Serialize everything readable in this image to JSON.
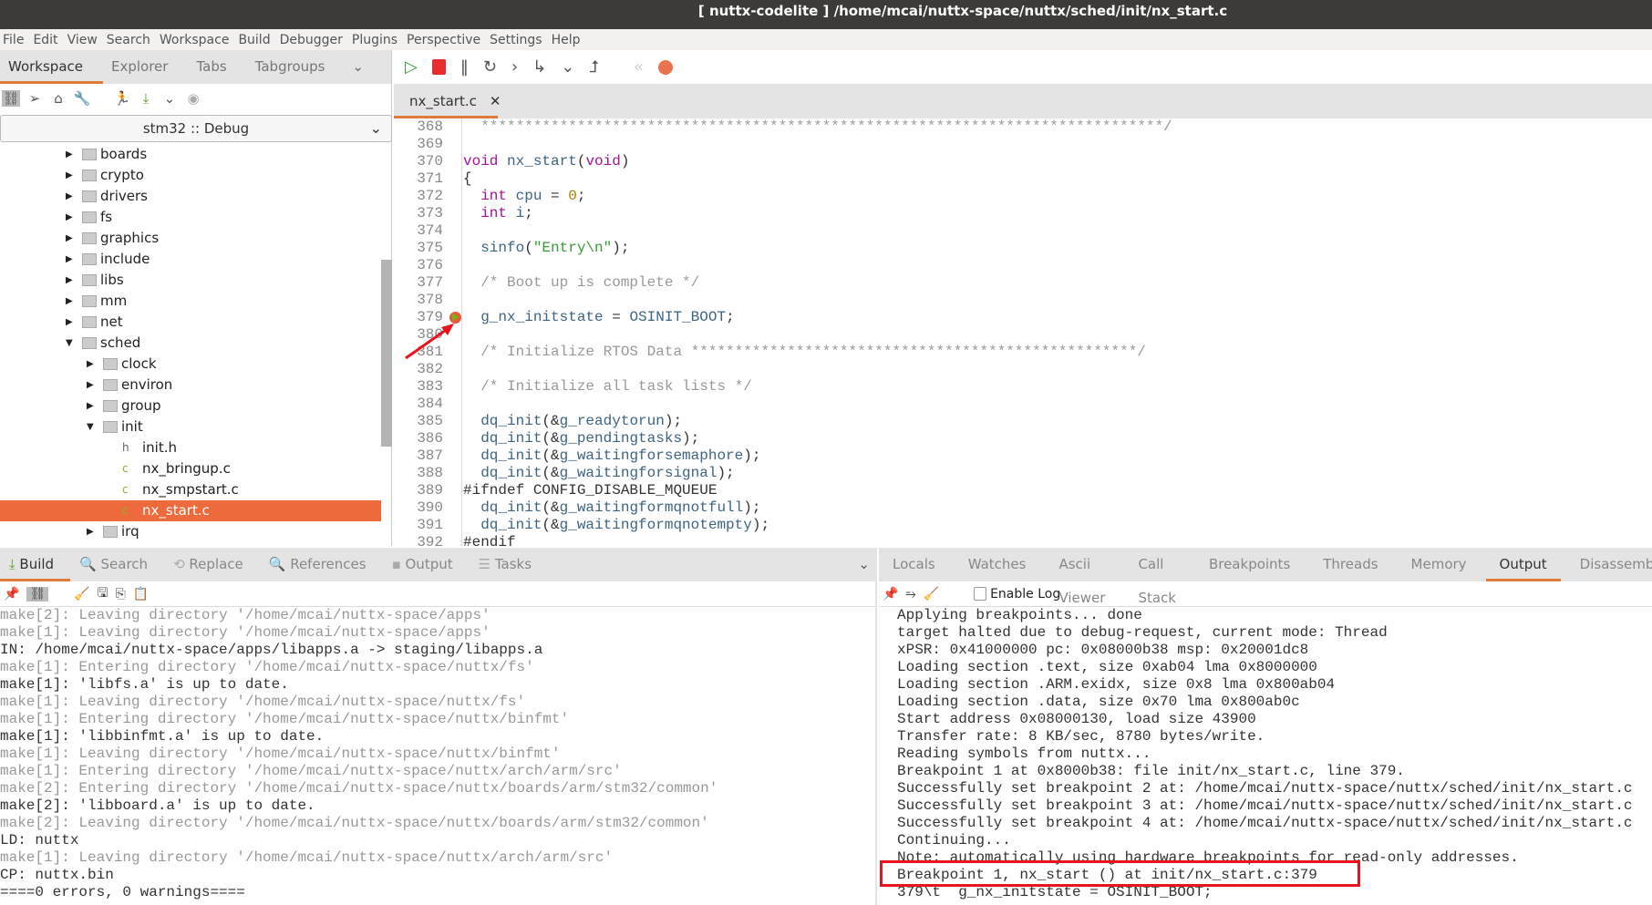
{
  "title": "[ nuttx-codelite ] /home/mcai/nuttx-space/nuttx/sched/init/nx_start.c",
  "menu": [
    "File",
    "Edit",
    "View",
    "Search",
    "Workspace",
    "Build",
    "Debugger",
    "Plugins",
    "Perspective",
    "Settings",
    "Help"
  ],
  "sidebar": {
    "tabs": [
      "Workspace",
      "Explorer",
      "Tabs",
      "Tabgroups"
    ],
    "project": "stm32 :: Debug",
    "tree": [
      {
        "label": "boards",
        "depth": 0,
        "type": "folder",
        "open": false
      },
      {
        "label": "crypto",
        "depth": 0,
        "type": "folder",
        "open": false
      },
      {
        "label": "drivers",
        "depth": 0,
        "type": "folder",
        "open": false
      },
      {
        "label": "fs",
        "depth": 0,
        "type": "folder",
        "open": false
      },
      {
        "label": "graphics",
        "depth": 0,
        "type": "folder",
        "open": false
      },
      {
        "label": "include",
        "depth": 0,
        "type": "folder",
        "open": false
      },
      {
        "label": "libs",
        "depth": 0,
        "type": "folder",
        "open": false
      },
      {
        "label": "mm",
        "depth": 0,
        "type": "folder",
        "open": false
      },
      {
        "label": "net",
        "depth": 0,
        "type": "folder",
        "open": false
      },
      {
        "label": "sched",
        "depth": 0,
        "type": "folder",
        "open": true
      },
      {
        "label": "clock",
        "depth": 1,
        "type": "folder",
        "open": false
      },
      {
        "label": "environ",
        "depth": 1,
        "type": "folder",
        "open": false
      },
      {
        "label": "group",
        "depth": 1,
        "type": "folder",
        "open": false
      },
      {
        "label": "init",
        "depth": 1,
        "type": "folder",
        "open": true
      },
      {
        "label": "init.h",
        "depth": 2,
        "type": "h"
      },
      {
        "label": "nx_bringup.c",
        "depth": 2,
        "type": "c"
      },
      {
        "label": "nx_smpstart.c",
        "depth": 2,
        "type": "c"
      },
      {
        "label": "nx_start.c",
        "depth": 2,
        "type": "c",
        "selected": true
      },
      {
        "label": "irq",
        "depth": 1,
        "type": "folder",
        "open": false
      }
    ]
  },
  "editor": {
    "tab": "nx_start.c",
    "breakpoint_line": 379,
    "lines": [
      {
        "n": "368",
        "t": [
          [
            "cm",
            "  ******************************************************************************/"
          ]
        ]
      },
      {
        "n": "369",
        "t": []
      },
      {
        "n": "370",
        "t": [
          [
            "kw",
            "void"
          ],
          [
            "pl",
            " "
          ],
          [
            "id",
            "nx_start"
          ],
          [
            "pl",
            "("
          ],
          [
            "kw",
            "void"
          ],
          [
            "pl",
            ")"
          ]
        ]
      },
      {
        "n": "371",
        "t": [
          [
            "pl",
            "{"
          ]
        ]
      },
      {
        "n": "372",
        "t": [
          [
            "pl",
            "  "
          ],
          [
            "kw",
            "int"
          ],
          [
            "id",
            " cpu "
          ],
          [
            "pl",
            "= "
          ],
          [
            "nm",
            "0"
          ],
          [
            "pl",
            ";"
          ]
        ]
      },
      {
        "n": "373",
        "t": [
          [
            "pl",
            "  "
          ],
          [
            "kw",
            "int"
          ],
          [
            "id",
            " i"
          ],
          [
            "pl",
            ";"
          ]
        ]
      },
      {
        "n": "374",
        "t": []
      },
      {
        "n": "375",
        "t": [
          [
            "pl",
            "  "
          ],
          [
            "id",
            "sinfo"
          ],
          [
            "pl",
            "("
          ],
          [
            "st",
            "\"Entry\\n\""
          ],
          [
            "pl",
            ");"
          ]
        ]
      },
      {
        "n": "376",
        "t": []
      },
      {
        "n": "377",
        "t": [
          [
            "cm",
            "  /* Boot up is complete */"
          ]
        ]
      },
      {
        "n": "378",
        "t": []
      },
      {
        "n": "379",
        "t": [
          [
            "pl",
            "  "
          ],
          [
            "id",
            "g_nx_initstate "
          ],
          [
            "pl",
            "= "
          ],
          [
            "id",
            "OSINIT_BOOT"
          ],
          [
            "pl",
            ";"
          ]
        ]
      },
      {
        "n": "380",
        "t": []
      },
      {
        "n": "381",
        "t": [
          [
            "cm",
            "  /* Initialize RTOS Data ***************************************************/"
          ]
        ]
      },
      {
        "n": "382",
        "t": []
      },
      {
        "n": "383",
        "t": [
          [
            "cm",
            "  /* Initialize all task lists */"
          ]
        ]
      },
      {
        "n": "384",
        "t": []
      },
      {
        "n": "385",
        "t": [
          [
            "pl",
            "  "
          ],
          [
            "id",
            "dq_init"
          ],
          [
            "pl",
            "(&"
          ],
          [
            "id",
            "g_readytorun"
          ],
          [
            "pl",
            ");"
          ]
        ]
      },
      {
        "n": "386",
        "t": [
          [
            "pl",
            "  "
          ],
          [
            "id",
            "dq_init"
          ],
          [
            "pl",
            "(&"
          ],
          [
            "id",
            "g_pendingtasks"
          ],
          [
            "pl",
            ");"
          ]
        ]
      },
      {
        "n": "387",
        "t": [
          [
            "pl",
            "  "
          ],
          [
            "id",
            "dq_init"
          ],
          [
            "pl",
            "(&"
          ],
          [
            "id",
            "g_waitingforsemaphore"
          ],
          [
            "pl",
            ");"
          ]
        ]
      },
      {
        "n": "388",
        "t": [
          [
            "pl",
            "  "
          ],
          [
            "id",
            "dq_init"
          ],
          [
            "pl",
            "(&"
          ],
          [
            "id",
            "g_waitingforsignal"
          ],
          [
            "pl",
            ");"
          ]
        ]
      },
      {
        "n": "389",
        "t": [
          [
            "pp",
            "#ifndef CONFIG_DISABLE_MQUEUE"
          ]
        ]
      },
      {
        "n": "390",
        "t": [
          [
            "pl",
            "  "
          ],
          [
            "id",
            "dq_init"
          ],
          [
            "pl",
            "(&"
          ],
          [
            "id",
            "g_waitingformqnotfull"
          ],
          [
            "pl",
            ");"
          ]
        ]
      },
      {
        "n": "391",
        "t": [
          [
            "pl",
            "  "
          ],
          [
            "id",
            "dq_init"
          ],
          [
            "pl",
            "(&"
          ],
          [
            "id",
            "g_waitingformqnotempty"
          ],
          [
            "pl",
            ");"
          ]
        ]
      },
      {
        "n": "392",
        "t": [
          [
            "pp",
            "#endif"
          ]
        ]
      }
    ]
  },
  "build_panel": {
    "tabs": [
      "Build",
      "Search",
      "Replace",
      "References",
      "Output",
      "Tasks"
    ],
    "lines": [
      {
        "dim": true,
        "text": "make[2]: Leaving directory '/home/mcai/nuttx-space/apps'"
      },
      {
        "dim": true,
        "text": "make[1]: Leaving directory '/home/mcai/nuttx-space/apps'"
      },
      {
        "dim": false,
        "text": "IN: /home/mcai/nuttx-space/apps/libapps.a -> staging/libapps.a"
      },
      {
        "dim": true,
        "text": "make[1]: Entering directory '/home/mcai/nuttx-space/nuttx/fs'"
      },
      {
        "dim": false,
        "text": "make[1]: 'libfs.a' is up to date."
      },
      {
        "dim": true,
        "text": "make[1]: Leaving directory '/home/mcai/nuttx-space/nuttx/fs'"
      },
      {
        "dim": true,
        "text": "make[1]: Entering directory '/home/mcai/nuttx-space/nuttx/binfmt'"
      },
      {
        "dim": false,
        "text": "make[1]: 'libbinfmt.a' is up to date."
      },
      {
        "dim": true,
        "text": "make[1]: Leaving directory '/home/mcai/nuttx-space/nuttx/binfmt'"
      },
      {
        "dim": true,
        "text": "make[1]: Entering directory '/home/mcai/nuttx-space/nuttx/arch/arm/src'"
      },
      {
        "dim": true,
        "text": "make[2]: Entering directory '/home/mcai/nuttx-space/nuttx/boards/arm/stm32/common'"
      },
      {
        "dim": false,
        "text": "make[2]: 'libboard.a' is up to date."
      },
      {
        "dim": true,
        "text": "make[2]: Leaving directory '/home/mcai/nuttx-space/nuttx/boards/arm/stm32/common'"
      },
      {
        "dim": false,
        "text": "LD: nuttx"
      },
      {
        "dim": true,
        "text": "make[1]: Leaving directory '/home/mcai/nuttx-space/nuttx/arch/arm/src'"
      },
      {
        "dim": false,
        "text": "CP: nuttx.bin"
      },
      {
        "dim": false,
        "text": "====0 errors, 0 warnings===="
      }
    ]
  },
  "debug_panel": {
    "tabs": [
      "Locals",
      "Watches",
      "Ascii Viewer",
      "Call Stack",
      "Breakpoints",
      "Threads",
      "Memory",
      "Output",
      "Disassembly"
    ],
    "active_tab": "Output",
    "enable_log_label": "Enable Log",
    "enable_log": false,
    "lines": [
      "Applying breakpoints... done",
      "target halted due to debug-request, current mode: Thread",
      "xPSR: 0x41000000 pc: 0x08000b38 msp: 0x20001dc8",
      "Loading section .text, size 0xab04 lma 0x8000000",
      "Loading section .ARM.exidx, size 0x8 lma 0x800ab04",
      "Loading section .data, size 0x70 lma 0x800ab0c",
      "Start address 0x08000130, load size 43900",
      "Transfer rate: 8 KB/sec, 8780 bytes/write.",
      "Reading symbols from nuttx...",
      "Breakpoint 1 at 0x8000b38: file init/nx_start.c, line 379.",
      "Successfully set breakpoint 2 at: /home/mcai/nuttx-space/nuttx/sched/init/nx_start.c",
      "Successfully set breakpoint 3 at: /home/mcai/nuttx-space/nuttx/sched/init/nx_start.c",
      "Successfully set breakpoint 4 at: /home/mcai/nuttx-space/nuttx/sched/init/nx_start.c",
      "Continuing...",
      "Note: automatically using hardware breakpoints for read-only addresses.",
      "Breakpoint 1, nx_start () at init/nx_start.c:379",
      "379\\t  g_nx_initstate = OSINIT_BOOT;"
    ]
  },
  "colors": {
    "accent": "#e07a3a",
    "selection": "#ec6a3b",
    "annotation": "#e8131b",
    "titlebar": "#3c3b37"
  }
}
